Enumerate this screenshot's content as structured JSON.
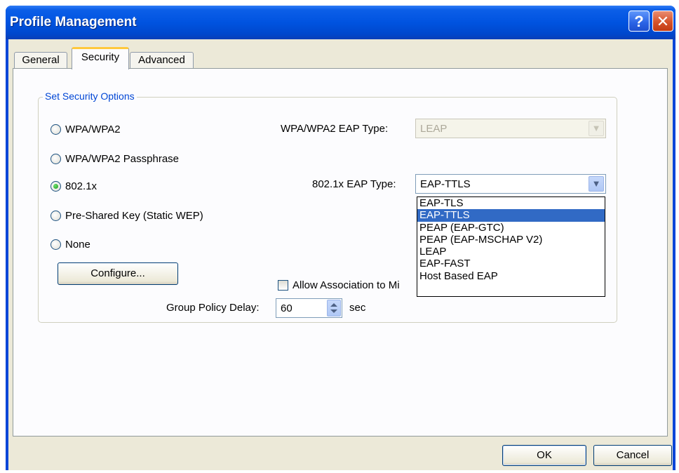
{
  "window": {
    "title": "Profile Management",
    "help_label": "?",
    "close_label": "✕"
  },
  "tabs": [
    {
      "label": "General"
    },
    {
      "label": "Security"
    },
    {
      "label": "Advanced"
    }
  ],
  "security": {
    "group_title": "Set Security Options",
    "options": [
      {
        "label": "WPA/WPA2",
        "checked": false
      },
      {
        "label": "WPA/WPA2 Passphrase",
        "checked": false
      },
      {
        "label": "802.1x",
        "checked": true
      },
      {
        "label": "Pre-Shared Key (Static WEP)",
        "checked": false
      },
      {
        "label": "None",
        "checked": false
      }
    ],
    "configure_label": "Configure...",
    "wpa_eap_label": "WPA/WPA2 EAP Type:",
    "wpa_eap_value": "LEAP",
    "dot1x_eap_label": "802.1x EAP Type:",
    "dot1x_eap_value": "EAP-TTLS",
    "dot1x_eap_options": [
      "EAP-TLS",
      "EAP-TTLS",
      "PEAP (EAP-GTC)",
      "PEAP (EAP-MSCHAP V2)",
      "LEAP",
      "EAP-FAST",
      "Host Based EAP"
    ],
    "dot1x_eap_selected_index": 1,
    "allow_assoc_label": "Allow Association to Mi",
    "group_policy_label": "Group Policy Delay:",
    "group_policy_value": "60",
    "group_policy_unit": "sec"
  },
  "buttons": {
    "ok": "OK",
    "cancel": "Cancel"
  }
}
